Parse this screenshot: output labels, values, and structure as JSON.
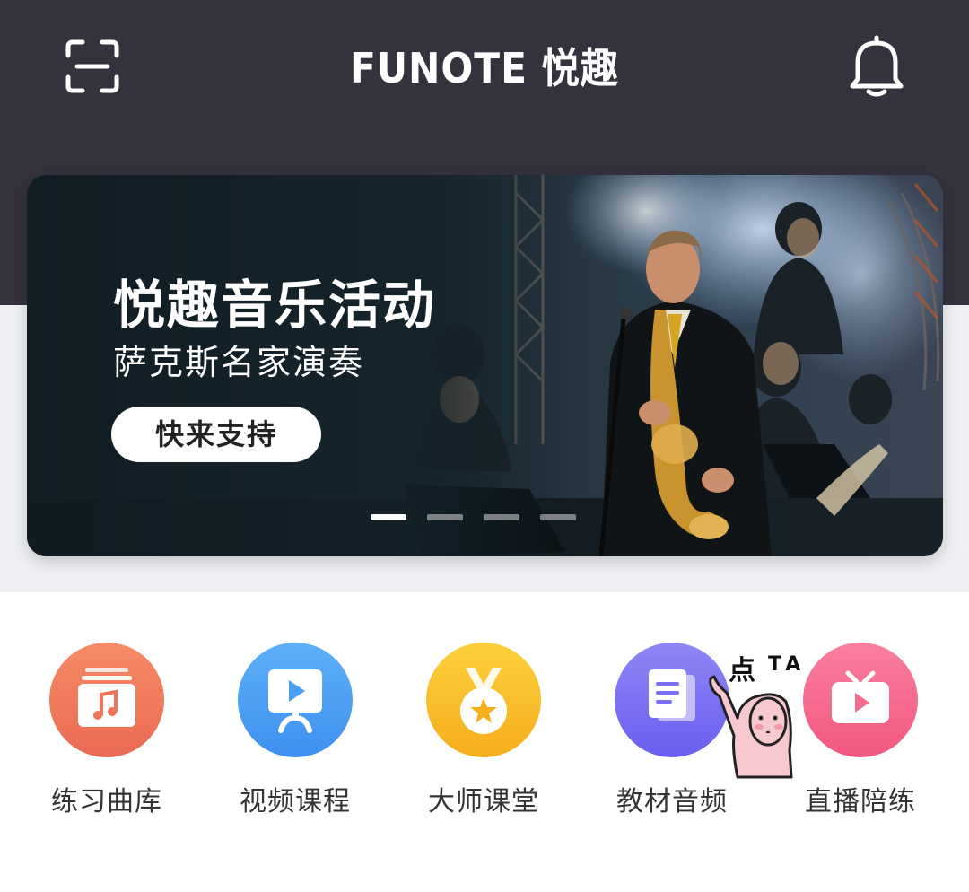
{
  "header": {
    "logo_text": "FUNOTE 悦趣",
    "scan_icon": "scan-icon",
    "bell_icon": "bell-icon",
    "background": "#34323d"
  },
  "banner": {
    "title": "悦趣音乐活动",
    "subtitle": "萨克斯名家演奏",
    "cta_label": "快来支持",
    "slide_count": 4,
    "active_slide": 1
  },
  "nav": {
    "items": [
      {
        "label": "练习曲库",
        "icon": "music-library-icon",
        "color": "#f07b5b"
      },
      {
        "label": "视频课程",
        "icon": "video-course-icon",
        "color": "#4a9ef5"
      },
      {
        "label": "大师课堂",
        "icon": "medal-icon",
        "color": "#fbbf2a"
      },
      {
        "label": "教材音频",
        "icon": "document-icon",
        "color": "#7c6ff2"
      },
      {
        "label": "直播陪练",
        "icon": "tv-icon",
        "color": "#f56b8e"
      }
    ],
    "sticker_text": "点",
    "sticker_text2": "TA"
  }
}
